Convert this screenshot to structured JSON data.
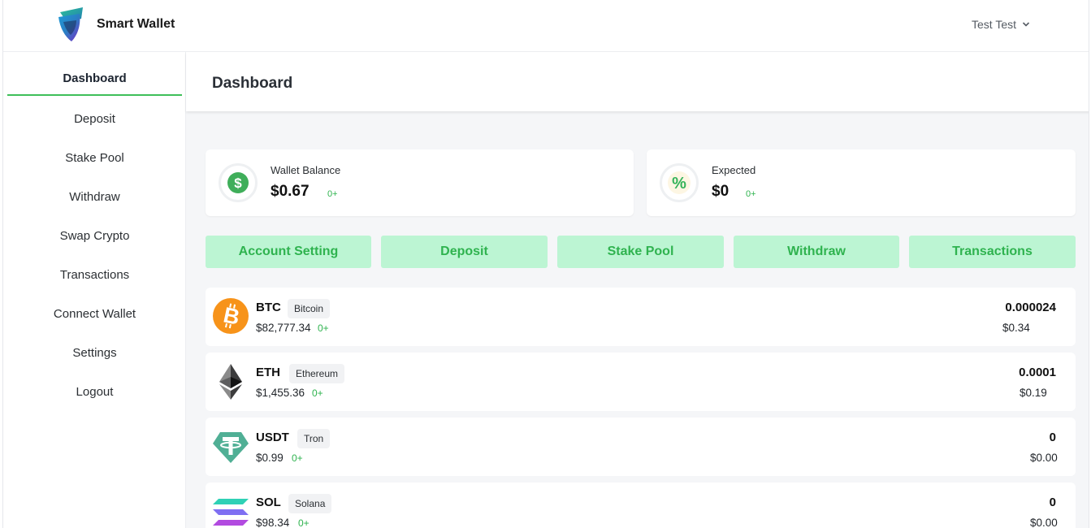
{
  "app": {
    "name": "Smart Wallet",
    "user_name": "Test Test"
  },
  "sidebar": {
    "items": [
      {
        "label": "Dashboard",
        "active": true
      },
      {
        "label": "Deposit"
      },
      {
        "label": "Stake Pool"
      },
      {
        "label": "Withdraw"
      },
      {
        "label": "Swap Crypto"
      },
      {
        "label": "Transactions"
      },
      {
        "label": "Connect Wallet"
      },
      {
        "label": "Settings"
      },
      {
        "label": "Logout"
      }
    ]
  },
  "page": {
    "title": "Dashboard"
  },
  "stats": {
    "wallet": {
      "label": "Wallet Balance",
      "value": "$0.67",
      "change": "0+",
      "icon": "dollar-icon"
    },
    "expected": {
      "label": "Expected",
      "value": "$0",
      "change": "0+",
      "icon": "percent-icon"
    }
  },
  "actions": [
    "Account Setting",
    "Deposit",
    "Stake Pool",
    "Withdraw",
    "Transactions"
  ],
  "coins": [
    {
      "symbol": "BTC",
      "network": "Bitcoin",
      "price": "$82,777.34",
      "change": "0+",
      "amount": "0.000024",
      "usd": "$0.34",
      "icon": "bitcoin-icon"
    },
    {
      "symbol": "ETH",
      "network": "Ethereum",
      "price": "$1,455.36",
      "change": "0+",
      "amount": "0.0001",
      "usd": "$0.19",
      "icon": "ethereum-icon"
    },
    {
      "symbol": "USDT",
      "network": "Tron",
      "price": "$0.99",
      "change": "0+",
      "amount": "0",
      "usd": "$0.00",
      "icon": "tether-icon"
    },
    {
      "symbol": "SOL",
      "network": "Solana",
      "price": "$98.34",
      "change": "0+",
      "amount": "0",
      "usd": "$0.00",
      "icon": "solana-icon"
    }
  ],
  "colors": {
    "accent_green": "#2fb34f",
    "button_bg": "#bcf5d3",
    "active_underline": "#3fbf5a",
    "btc_orange": "#f7931a",
    "usdt_green": "#50af95"
  }
}
